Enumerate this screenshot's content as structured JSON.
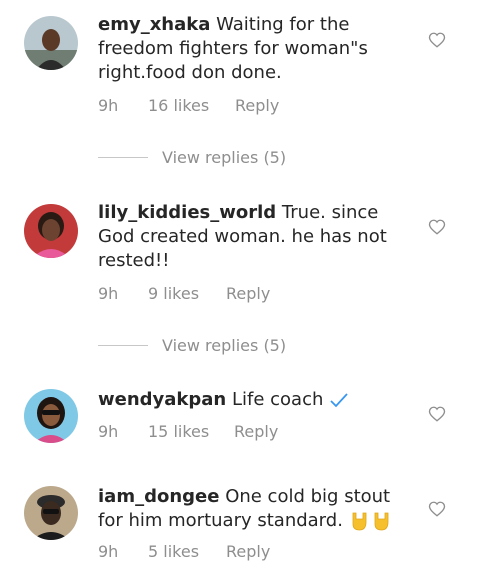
{
  "comments": [
    {
      "username": "emy_xhaka",
      "text": "Waiting for the freedom fighters for woman\"s right.food don done.",
      "time": "9h",
      "likes": "16 likes",
      "reply_label": "Reply",
      "view_replies": "View replies (5)"
    },
    {
      "username": "lily_kiddies_world",
      "text": "True. since God created woman. he has not rested!!",
      "time": "9h",
      "likes": "9 likes",
      "reply_label": "Reply",
      "view_replies": "View replies (5)"
    },
    {
      "username": "wendyakpan",
      "text": "Life coach",
      "time": "9h",
      "likes": "15 likes",
      "reply_label": "Reply"
    },
    {
      "username": "iam_dongee",
      "text": "One cold big stout for him  mortuary standard.",
      "time": "9h",
      "likes": "5 likes",
      "reply_label": "Reply"
    }
  ],
  "icons": {
    "like": "heart-outline-icon",
    "verified": "checkmark-icon",
    "emoji": "rock-on-hand-emoji"
  },
  "colors": {
    "text": "#262626",
    "meta": "#8e8e8e",
    "verified": "#3897f0",
    "emoji": "#f5c02c"
  }
}
